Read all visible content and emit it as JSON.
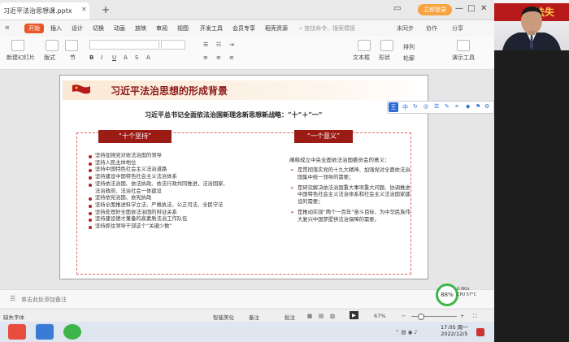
{
  "app": {
    "doc_tab": "习近平法治思想课.pptx",
    "login_label": "立即登录",
    "window_controls": [
      "▭",
      "—",
      "□",
      "✕"
    ]
  },
  "menu": {
    "items": [
      "开始",
      "插入",
      "设计",
      "切换",
      "动画",
      "放映",
      "审阅",
      "视图",
      "开发工具",
      "会员专享",
      "稻壳资源"
    ],
    "search_placeholder": "查找命令、搜索模板",
    "right": [
      "未同步",
      "协作",
      "分享"
    ]
  },
  "toolbar": {
    "new_slide": "新建幻灯片",
    "layout": "版式",
    "section": "节",
    "font_placeholder": "",
    "textbox": "文本框",
    "shape": "形状",
    "arrange": "排列",
    "outline": "轮廓",
    "play": "演示工具"
  },
  "slide": {
    "title": "习近平法治思想的形成背景",
    "subtitle": "习近平总书记全面依法治国新理念新思想新战略：“十”＋“一”",
    "left_head": "“十个坚持”",
    "right_head": "“一个意义”",
    "left_items": [
      "坚持加强党对依法治国的领导",
      "坚持人民主体地位",
      "坚持中国特色社会主义法治道路",
      "坚持建设中国特色社会主义法治体系",
      "坚持依法治国、依法执政、依法行政共同推进，法治国家、",
      "法治政府、法治社会一体建设",
      "坚持依宪治国、依宪执政",
      "坚持全面推进科学立法、严格执法、公正司法、全民守法",
      "坚持处理好全面依法治国的辩证关系",
      "坚持建设德才兼备的高素质法治工作队伍",
      "坚持抓住领导干部这个“关键少数”"
    ],
    "right_intro": "阐释成立中央全面依法治国委员会的意义：",
    "right_items": [
      "是贯彻落实党的十九大精神、加强党对全面依法治国集中统一领导的需要；",
      "是研究解决依法治国重大事项重大问题、协调推进中国特色社会主义法治体系和社会主义法治国家建设的需要；",
      "是推动实现“两个一百年”奋斗目标、为中华民族伟大复兴中国梦提供法治保障的需要。"
    ]
  },
  "float_bar": {
    "badge": "王",
    "label": "中"
  },
  "ime": {
    "badge": "S",
    "label": "英"
  },
  "notes": {
    "placeholder": "单击此处添加备注"
  },
  "status": {
    "left": "缺失字体",
    "smart": "智能美化",
    "notes_btn": "备注",
    "comment": "批注",
    "zoom": "67%"
  },
  "gauge": {
    "value": "88%",
    "up": "0.0K/s",
    "cpu": "CPU 57°C"
  },
  "clock": {
    "time": "17:05 周一",
    "date": "2022/12/5"
  },
  "video": {
    "banner": "法失"
  }
}
